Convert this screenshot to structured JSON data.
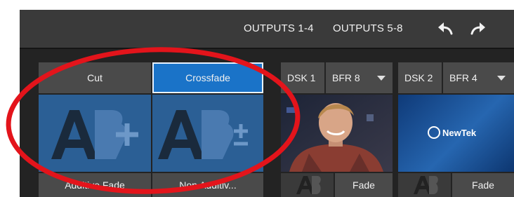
{
  "toolbar": {
    "outputs_1_4": "OUTPUTS 1-4",
    "outputs_5_8": "OUTPUTS 5-8",
    "undo_icon": "undo-arrow-icon",
    "redo_icon": "redo-arrow-icon"
  },
  "transition": {
    "cut_label": "Cut",
    "crossfade_label": "Crossfade",
    "additive_label": "Additive Fade",
    "non_additive_label": "Non Additiv...",
    "additive_icon_text": "A",
    "additive_symbol": "+",
    "non_additive_symbol": "±"
  },
  "dsk1": {
    "label": "DSK 1",
    "source": "BFR 8",
    "transition_label": "Fade"
  },
  "dsk2": {
    "label": "DSK 2",
    "source": "BFR 4",
    "logo_text": "NewTek",
    "transition_label": "Fade"
  },
  "colors": {
    "accent": "#1a73c8",
    "annotation": "#e3141b"
  }
}
